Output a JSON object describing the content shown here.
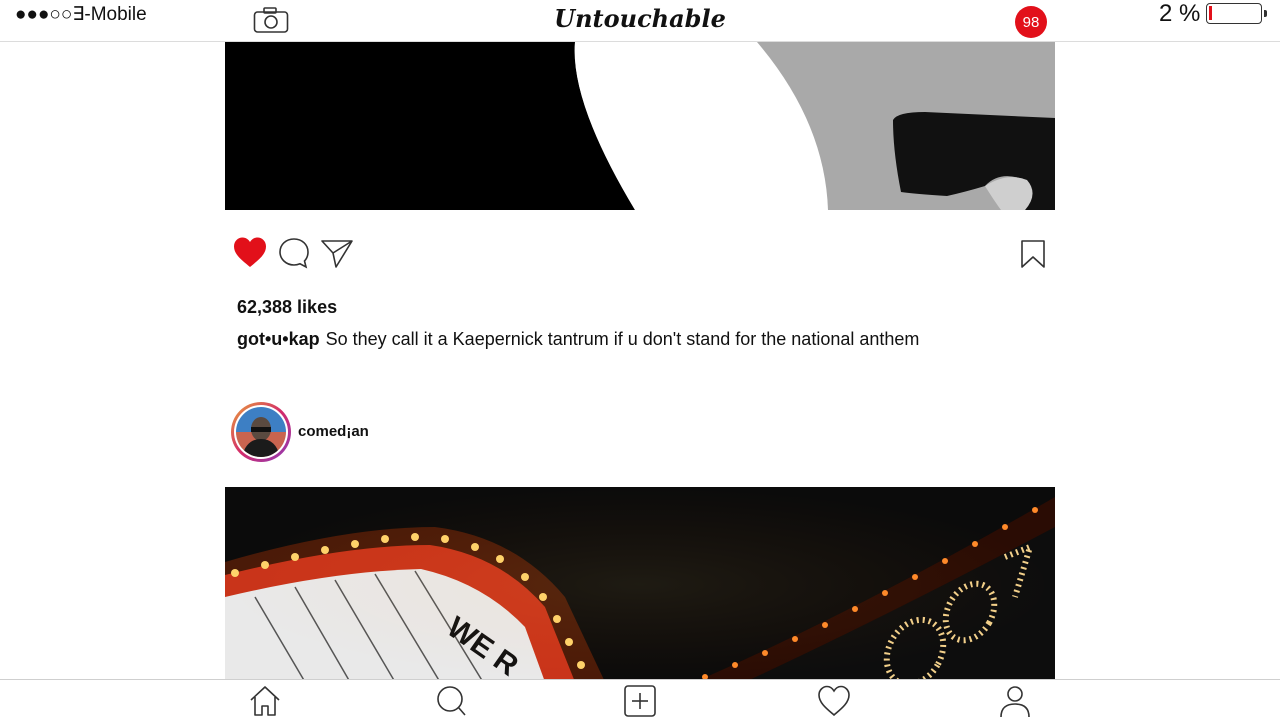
{
  "status": {
    "carrier": "●●●○○∃-Mobile",
    "battery_percent_text": "2 %",
    "battery_level": 0.02
  },
  "header": {
    "brand": "Untouchable",
    "notification_count": "98"
  },
  "post1": {
    "likes": "62,388 likes",
    "username": "got•u•kap",
    "caption": "So they call it a Kaepernick tantrum if u don't stand for the national anthem",
    "liked": true
  },
  "post2": {
    "username": "comed¡an"
  },
  "icons": [
    "camera-icon",
    "heart-icon",
    "comment-icon",
    "share-icon",
    "bookmark-icon",
    "home-icon",
    "search-icon",
    "add-icon",
    "activity-icon",
    "profile-icon"
  ],
  "colors": {
    "accent_red": "#e2101a",
    "text": "#111111"
  }
}
